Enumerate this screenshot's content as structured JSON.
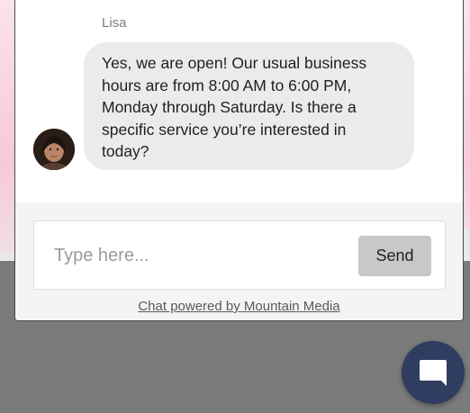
{
  "chat": {
    "sender": "Lisa",
    "message_lines": [
      "Yes, we are open! Our usual business",
      "hours are from 8:00 AM to 6:00 PM,",
      "Monday through Saturday. Is there a",
      "specific service you’re interested in",
      "today?"
    ],
    "avatar_icon": "agent-avatar"
  },
  "composer": {
    "placeholder": "Type here...",
    "value": "",
    "send_label": "Send"
  },
  "footer": {
    "powered_by": "Chat powered by Mountain Media"
  },
  "launcher": {
    "icon": "chat-bubble-icon",
    "color": "#2f3d60"
  }
}
